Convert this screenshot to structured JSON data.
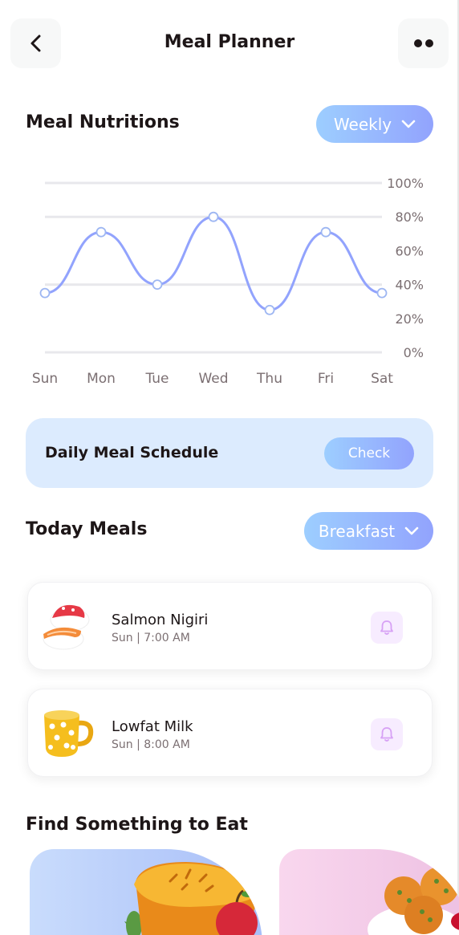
{
  "header": {
    "title": "Meal Planner",
    "back_icon": "chevron-left-icon",
    "more_icon": "more-dots-icon"
  },
  "nutrition": {
    "title": "Meal Nutritions",
    "period_label": "Weekly"
  },
  "chart_data": {
    "type": "line",
    "categories": [
      "Sun",
      "Mon",
      "Tue",
      "Wed",
      "Thu",
      "Fri",
      "Sat"
    ],
    "values": [
      35,
      71,
      40,
      80,
      25,
      71,
      35
    ],
    "y_ticks": [
      "100%",
      "80%",
      "60%",
      "40%",
      "20%",
      "0%"
    ],
    "ylim": [
      0,
      100
    ],
    "grid": true,
    "line_color": "#92A3FD"
  },
  "schedule": {
    "label": "Daily Meal Schedule",
    "button_label": "Check"
  },
  "today": {
    "title": "Today Meals",
    "filter_label": "Breakfast",
    "meals": [
      {
        "name": "Salmon Nigiri",
        "time": "Sun | 7:00 AM",
        "icon": "sushi-icon"
      },
      {
        "name": "Lowfat Milk",
        "time": "Sun | 8:00 AM",
        "icon": "milk-mug-icon"
      }
    ]
  },
  "find": {
    "title": "Find Something to Eat"
  },
  "colors": {
    "accent_start": "#9DCEFF",
    "accent_end": "#92A3FD",
    "text": "#1D1617",
    "muted": "#7B6F72"
  }
}
